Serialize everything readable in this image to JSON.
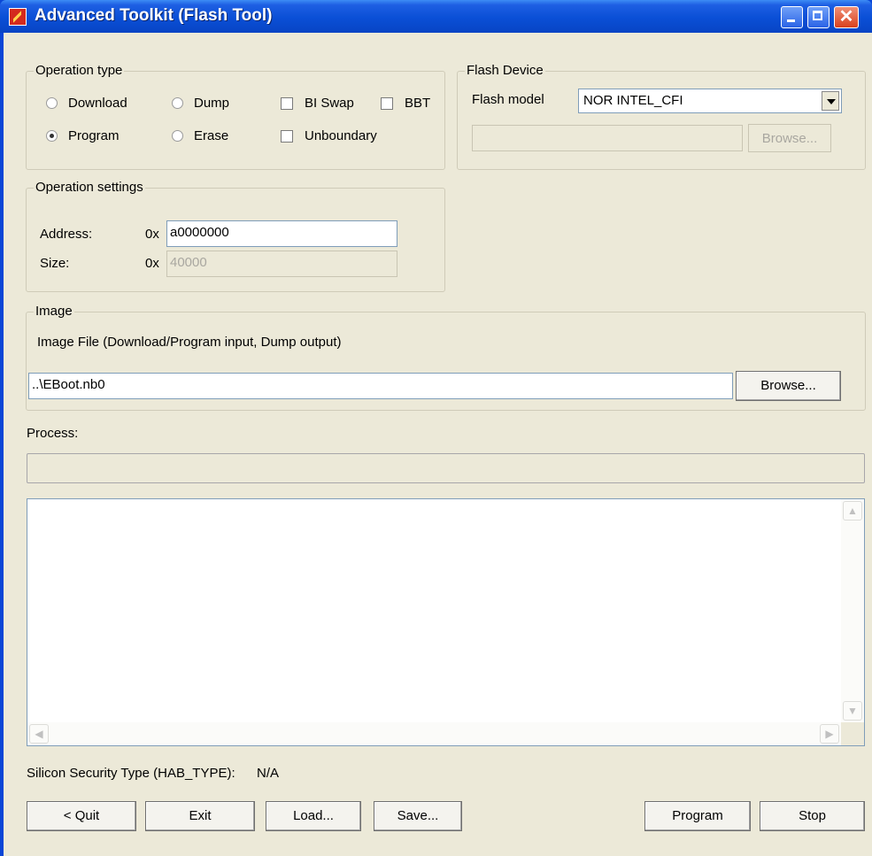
{
  "window": {
    "title": "Advanced Toolkit (Flash Tool)"
  },
  "operation_type": {
    "title": "Operation type",
    "radios": [
      {
        "label": "Download",
        "selected": false
      },
      {
        "label": "Dump",
        "selected": false
      },
      {
        "label": "Program",
        "selected": true
      },
      {
        "label": "Erase",
        "selected": false
      }
    ],
    "checkboxes": [
      {
        "label": "BI Swap",
        "checked": false
      },
      {
        "label": "BBT",
        "checked": false
      },
      {
        "label": "Unboundary",
        "checked": false
      }
    ]
  },
  "flash_device": {
    "title": "Flash Device",
    "model_label": "Flash model",
    "model_value": "NOR INTEL_CFI",
    "path_value": "",
    "browse_label": "Browse..."
  },
  "operation_settings": {
    "title": "Operation settings",
    "address_label": "Address:",
    "address_prefix": "0x",
    "address_value": "a0000000",
    "size_label": "Size:",
    "size_prefix": "0x",
    "size_value": "40000"
  },
  "image": {
    "title": "Image",
    "description": "Image File (Download/Program input, Dump output)",
    "file_value": "..\\EBoot.nb0",
    "browse_label": "Browse..."
  },
  "process": {
    "label": "Process:",
    "progress": 0
  },
  "log": {
    "content": ""
  },
  "security": {
    "label": "Silicon Security Type (HAB_TYPE):",
    "value": "N/A"
  },
  "buttons": {
    "quit": "< Quit",
    "exit": "Exit",
    "load": "Load...",
    "save": "Save...",
    "program": "Program",
    "stop": "Stop"
  },
  "scroll_glyphs": {
    "up": "▲",
    "down": "▼",
    "left": "◀",
    "right": "▶"
  }
}
